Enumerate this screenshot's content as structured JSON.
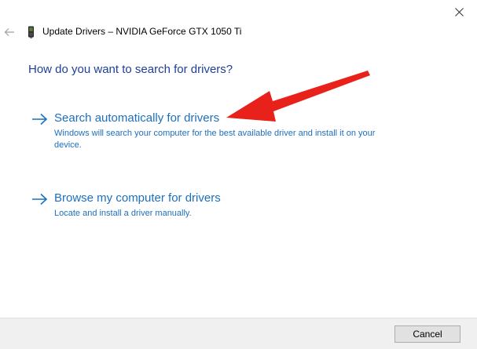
{
  "window": {
    "title": "Update Drivers – NVIDIA GeForce GTX 1050 Ti",
    "close_icon": "close-icon",
    "back_icon": "back-arrow-icon",
    "device_icon": "graphics-card-icon"
  },
  "main": {
    "heading": "How do you want to search for drivers?",
    "options": [
      {
        "title": "Search automatically for drivers",
        "description": "Windows will search your computer for the best available driver and install it on your device.",
        "icon": "arrow-right-icon"
      },
      {
        "title": "Browse my computer for drivers",
        "description": "Locate and install a driver manually.",
        "icon": "arrow-right-icon"
      }
    ]
  },
  "footer": {
    "cancel_label": "Cancel"
  },
  "colors": {
    "heading": "#1e3f9a",
    "link": "#1c6fbf",
    "annotation_arrow": "#e8211a",
    "footer_bg": "#f0f0f0"
  }
}
